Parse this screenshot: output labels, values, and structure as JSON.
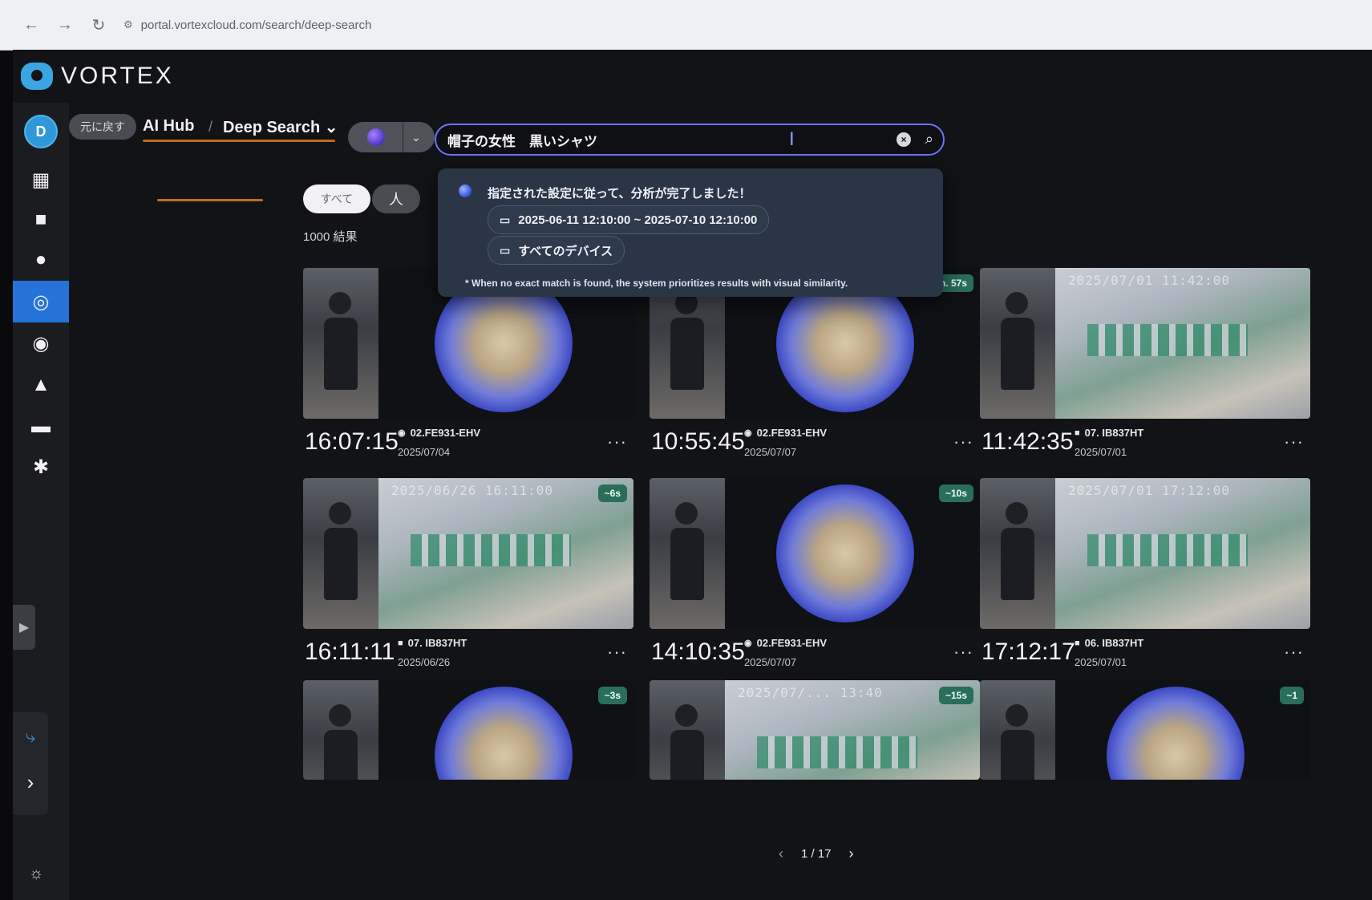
{
  "browser": {
    "url": "portal.vortexcloud.com/search/deep-search",
    "nav": {
      "back": "←",
      "forward": "→",
      "reload": "↻"
    }
  },
  "app": {
    "brand": "VORTEX"
  },
  "sidebar": {
    "avatar_initial": "D",
    "items": [
      {
        "icon": "dashboard-icon",
        "glyph": "▦"
      },
      {
        "icon": "camera-icon",
        "glyph": "■"
      },
      {
        "icon": "person-icon",
        "glyph": "●"
      },
      {
        "icon": "ai-hub-icon",
        "glyph": "◎"
      },
      {
        "icon": "face-icon",
        "glyph": "◉"
      },
      {
        "icon": "bell-icon",
        "glyph": "▲"
      },
      {
        "icon": "archive-icon",
        "glyph": "▬"
      },
      {
        "icon": "gear-icon",
        "glyph": "✱"
      }
    ],
    "collapse_glyph": "▶",
    "expand_glyph": "›",
    "assistant_glyph": "⤷",
    "theme_glyph": "☼"
  },
  "breadcrumb": {
    "back_label": "元に戻す",
    "hub": "AI Hub",
    "separator": "/",
    "page": "Deep Search",
    "page_chevron": "⌄"
  },
  "search": {
    "mode_chevron": "⌄",
    "query": "帽子の女性　黒いシャツ",
    "clear_glyph": "×",
    "search_glyph": "⌕"
  },
  "popover": {
    "message": "指定された設定に従って、分析が完了しました！",
    "date_range": "2025-06-11 12:10:00 ~ 2025-07-10 12:10:00",
    "devices": "すべてのデバイス",
    "calendar_glyph": "▭",
    "device_glyph": "▭",
    "note": "* When no exact match is found, the system prioritizes results with visual similarity."
  },
  "filters": {
    "all_label": "すべて",
    "person_label": "人",
    "result_count": "1000 結果"
  },
  "results": [
    {
      "time": "16:07:15",
      "camera": "02.FE931-EHV",
      "date": "2025/07/04",
      "cam_glyph": "◉",
      "view": "fisheye",
      "duration": "",
      "stamp": ""
    },
    {
      "time": "10:55:45",
      "camera": "02.FE931-EHV",
      "date": "2025/07/07",
      "cam_glyph": "◉",
      "view": "fisheye",
      "duration": "n. 57s",
      "stamp": ""
    },
    {
      "time": "11:42:35",
      "camera": "07. IB837HT",
      "date": "2025/07/01",
      "cam_glyph": "■",
      "view": "panorama",
      "duration": "",
      "stamp": "2025/07/01 11:42:00"
    },
    {
      "time": "16:11:11",
      "camera": "07. IB837HT",
      "date": "2025/06/26",
      "cam_glyph": "■",
      "view": "panorama",
      "duration": "~6s",
      "stamp": "2025/06/26 16:11:00"
    },
    {
      "time": "14:10:35",
      "camera": "02.FE931-EHV",
      "date": "2025/07/07",
      "cam_glyph": "◉",
      "view": "fisheye",
      "duration": "~10s",
      "stamp": ""
    },
    {
      "time": "17:12:17",
      "camera": "06. IB837HT",
      "date": "2025/07/01",
      "cam_glyph": "■",
      "view": "panorama",
      "duration": "",
      "stamp": "2025/07/01 17:12:00"
    },
    {
      "time": "",
      "camera": "",
      "date": "",
      "cam_glyph": "",
      "view": "fisheye",
      "duration": "~3s",
      "stamp": ""
    },
    {
      "time": "",
      "camera": "",
      "date": "",
      "cam_glyph": "",
      "view": "panorama",
      "duration": "~15s",
      "stamp": "2025/07/... 13:40"
    },
    {
      "time": "",
      "camera": "",
      "date": "",
      "cam_glyph": "",
      "view": "fisheye",
      "duration": "~1",
      "stamp": ""
    }
  ],
  "pager": {
    "prev": "‹",
    "label": "1 / 17",
    "next": "›"
  }
}
